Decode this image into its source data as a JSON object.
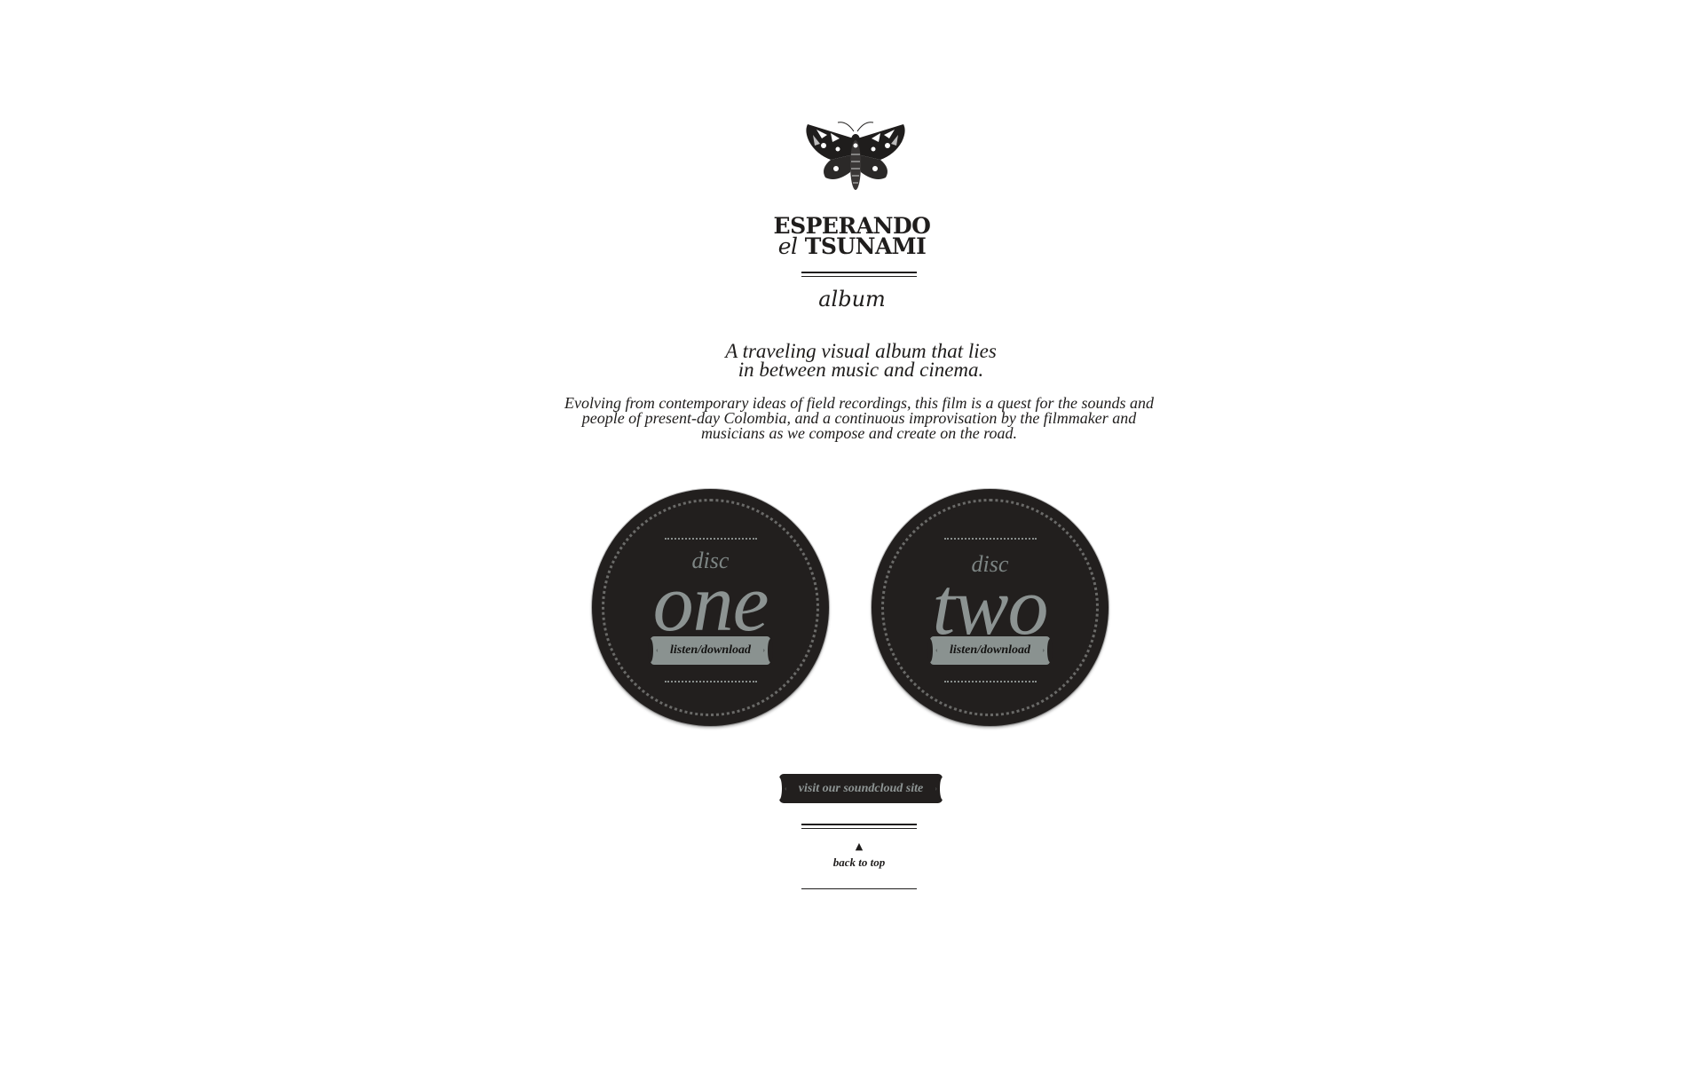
{
  "header": {
    "title_line1": "ESPERANDO",
    "title_line2_prefix": "el",
    "title_line2": "TSUNAMI",
    "section": "album"
  },
  "intro": {
    "tagline_line1": "A traveling visual album that lies",
    "tagline_line2": "in between music and cinema.",
    "description_line1": "Evolving from contemporary ideas of field recordings, this film is a quest for the sounds and",
    "description_line2": "people of present-day Colombia, and a continuous improvisation by the filmmaker and",
    "description_line3": "musicians as we compose and create on the road."
  },
  "discs": [
    {
      "small": "disc",
      "big": "one",
      "button": "listen/download"
    },
    {
      "small": "disc",
      "big": "two",
      "button": "listen/download"
    }
  ],
  "soundcloud": {
    "label": "visit our soundcloud site"
  },
  "back_to_top": {
    "label": "back to top",
    "arrow": "▲"
  },
  "icons": {
    "logo": "moth-icon",
    "button_arrow_left": "‹",
    "button_arrow_right": "›"
  },
  "colors": {
    "background": "#ffffff",
    "ink": "#1f1d1c",
    "disc": "#221f1e",
    "disc_text": "#8c9392",
    "button_fill": "#8a9290"
  }
}
